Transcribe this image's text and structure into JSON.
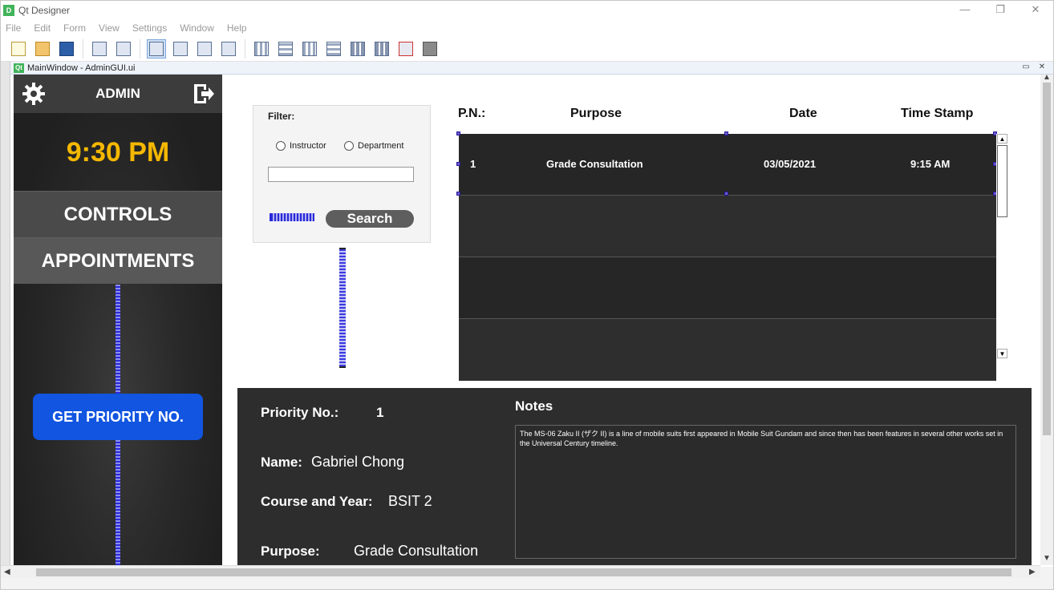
{
  "window": {
    "app_title": "Qt Designer",
    "logo": "D",
    "controls": [
      "—",
      "❐",
      "✕"
    ]
  },
  "menu": [
    "File",
    "Edit",
    "Form",
    "View",
    "Settings",
    "Window",
    "Help"
  ],
  "subwindow": {
    "badge": "Qt",
    "title": "MainWindow - AdminGUI.ui",
    "controls": [
      "▭",
      "✕"
    ]
  },
  "sidebar": {
    "admin_label": "ADMIN",
    "time": "9:30 PM",
    "controls_label": "CONTROLS",
    "appointments_label": "APPOINTMENTS",
    "priority_button": "GET PRIORITY NO."
  },
  "filter": {
    "title": "Filter:",
    "options": [
      "Instructor",
      "Department"
    ],
    "input_value": "",
    "search_label": "Search"
  },
  "table": {
    "headers": {
      "pn": "P.N.:",
      "purpose": "Purpose",
      "date": "Date",
      "time_stamp": "Time Stamp"
    },
    "rows": [
      {
        "pn": "1",
        "purpose": "Grade Consultation",
        "date": "03/05/2021",
        "time": "9:15 AM"
      },
      {
        "pn": "",
        "purpose": "",
        "date": "",
        "time": ""
      },
      {
        "pn": "",
        "purpose": "",
        "date": "",
        "time": ""
      },
      {
        "pn": "",
        "purpose": "",
        "date": "",
        "time": ""
      }
    ]
  },
  "details": {
    "priority_label": "Priority No.:",
    "priority_value": "1",
    "name_label": "Name:",
    "name_value": "Gabriel Chong",
    "course_label": "Course and Year:",
    "course_value": "BSIT 2",
    "purpose_label": "Purpose:",
    "purpose_value": "Grade Consultation",
    "notes_label": "Notes",
    "notes_text": "The MS-06 Zaku II (ザク II) is a line of mobile suits first appeared in Mobile Suit Gundam and since then has been features in several other works set in the Universal Century timeline."
  },
  "colors": {
    "accent_time": "#f5b800",
    "priority_button": "#1155e0",
    "panel_dark": "#2d2d2d"
  }
}
